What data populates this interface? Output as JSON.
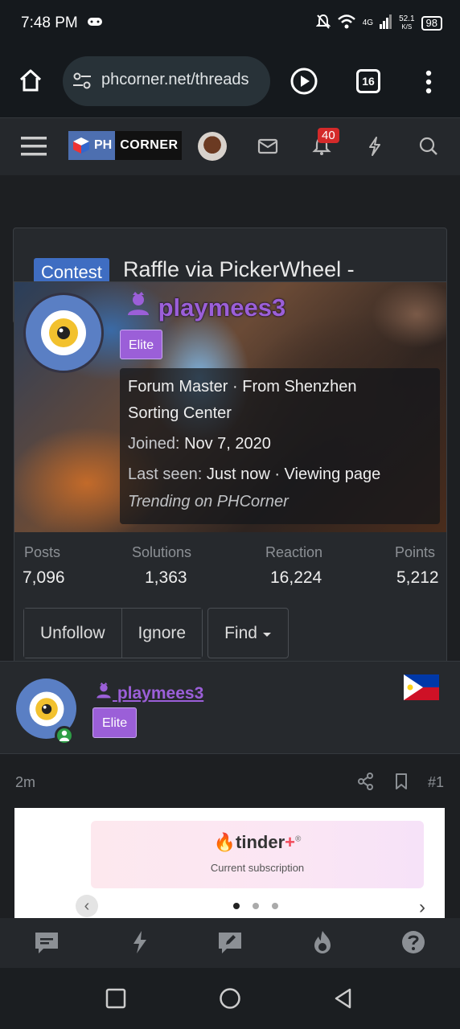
{
  "status_bar": {
    "time": "7:48 PM",
    "network_type": "4G",
    "speed": "52.1",
    "speed_unit": "K/S",
    "battery": "98"
  },
  "browser": {
    "url": "phcorner.net/threads",
    "tab_count": "16"
  },
  "site_header": {
    "logo_ph": "PH",
    "logo_corner": "CORNER",
    "notification_count": "40"
  },
  "thread": {
    "prefix": "Contest",
    "title": "Raffle via PickerWheel -"
  },
  "member_tooltip": {
    "username": "playmees3",
    "badge": "Elite",
    "title_line1": "Forum Master · From Shenzhen",
    "title_line2": "Sorting Center",
    "joined_label": "Joined:",
    "joined_value": "Nov 7, 2020",
    "last_seen_label": "Last seen:",
    "last_seen_value": "Just now · Viewing page",
    "activity": "Trending on PHCorner",
    "stats": [
      {
        "label": "Posts",
        "value": "7,096"
      },
      {
        "label": "Solutions",
        "value": "1,363"
      },
      {
        "label": "Reaction",
        "value": "16,224"
      },
      {
        "label": "Points",
        "value": "5,212"
      }
    ],
    "actions": {
      "unfollow": "Unfollow",
      "ignore": "Ignore",
      "find": "Find"
    }
  },
  "post": {
    "author": "playmees3",
    "badge": "Elite",
    "time": "2m",
    "number": "#1",
    "image": {
      "brand": "tinder",
      "plus": "+",
      "reg": "®",
      "subtitle": "Current subscription"
    }
  },
  "colors": {
    "accent_purple": "#9b5fd8",
    "contest_blue": "#3f6dc2",
    "badge_red": "#d42a2a",
    "online_green": "#2e9e46"
  },
  "icons": {
    "home": "home-icon",
    "tune": "site-settings-icon",
    "play": "play-icon",
    "menu": "more-vert-icon",
    "hamburger": "hamburger-icon",
    "mail": "mail-icon",
    "bell": "bell-icon",
    "lightning": "lightning-icon",
    "search": "search-icon",
    "share": "share-icon",
    "bookmark": "bookmark-icon"
  }
}
